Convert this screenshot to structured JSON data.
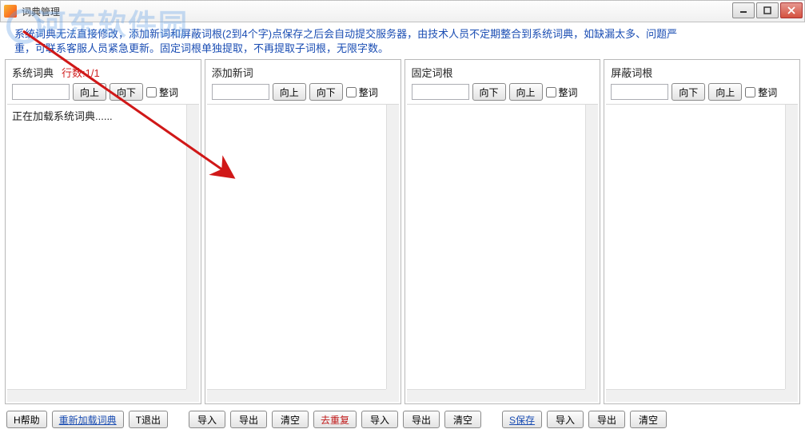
{
  "window": {
    "title": "词典管理"
  },
  "watermark": "河东软件园",
  "info": {
    "line1": "系统词典无法直接修改，添加新词和屏蔽词根(2到4个字)点保存之后会自动提交服务器，由技术人员不定期整合到系统词典，如缺漏太多、问题严",
    "line2": "重，可联系客服人员紧急更新。固定词根单独提取，不再提取子词根，无限字数。"
  },
  "panels": {
    "system": {
      "title": "系统词典",
      "line_count": "行数:1/1",
      "btn_up": "向上",
      "btn_down": "向下",
      "checkbox": "整词",
      "body_text": "正在加载系统词典......"
    },
    "add": {
      "title": "添加新词",
      "btn_up": "向上",
      "btn_down": "向下",
      "checkbox": "整词"
    },
    "fixed": {
      "title": "固定词根",
      "btn_up": "向下",
      "btn_down": "向上",
      "checkbox": "整词"
    },
    "mask": {
      "title": "屏蔽词根",
      "btn_up": "向下",
      "btn_down": "向上",
      "checkbox": "整词"
    }
  },
  "bottom": {
    "help": "H帮助",
    "reload": "重新加载词典",
    "exit": "T退出",
    "import": "导入",
    "export": "导出",
    "clear": "清空",
    "dedupe": "去重复",
    "save": "S保存"
  }
}
